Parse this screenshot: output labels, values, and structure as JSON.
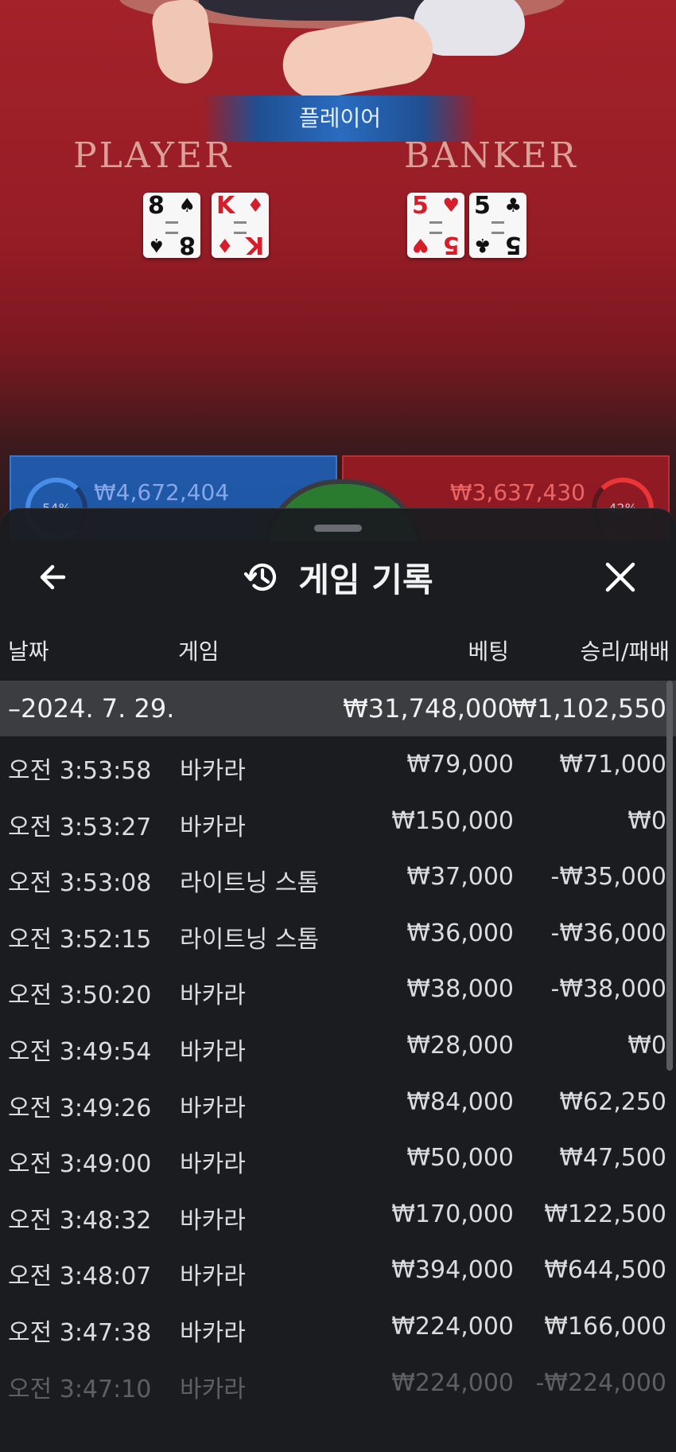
{
  "table": {
    "winner_banner": "플레이어",
    "player_title": "PLAYER",
    "banker_title": "BANKER",
    "player_cards": [
      {
        "rank": "8",
        "suit": "♠",
        "color": "#111111"
      },
      {
        "rank": "K",
        "suit": "♦",
        "color": "#d61e2b"
      }
    ],
    "banker_cards": [
      {
        "rank": "5",
        "suit": "♥",
        "color": "#d61e2b"
      },
      {
        "rank": "5",
        "suit": "♣",
        "color": "#111111"
      }
    ],
    "player_percent": "54%",
    "player_amount": "₩4,672,404",
    "banker_amount": "₩3,637,430",
    "banker_percent": "42%"
  },
  "sheet": {
    "title": "게임 기록",
    "back_icon": "arrow-left-icon",
    "history_icon": "history-icon",
    "close_icon": "close-icon",
    "columns": {
      "date": "날짜",
      "game": "게임",
      "bet": "베팅",
      "win_loss": "승리/패배"
    },
    "date_group": {
      "date": "–2024. 7. 29.",
      "total_bet": "₩31,748,000",
      "total_win": "₩1,102,550"
    },
    "rows": [
      {
        "time": "오전 3:53:58",
        "game": "바카라",
        "bet": "₩79,000",
        "result": "₩71,000"
      },
      {
        "time": "오전 3:53:27",
        "game": "바카라",
        "bet": "₩150,000",
        "result": "₩0"
      },
      {
        "time": "오전 3:53:08",
        "game": "라이트닝 스톰",
        "bet": "₩37,000",
        "result": "-₩35,000"
      },
      {
        "time": "오전 3:52:15",
        "game": "라이트닝 스톰",
        "bet": "₩36,000",
        "result": "-₩36,000"
      },
      {
        "time": "오전 3:50:20",
        "game": "바카라",
        "bet": "₩38,000",
        "result": "-₩38,000"
      },
      {
        "time": "오전 3:49:54",
        "game": "바카라",
        "bet": "₩28,000",
        "result": "₩0"
      },
      {
        "time": "오전 3:49:26",
        "game": "바카라",
        "bet": "₩84,000",
        "result": "₩62,250"
      },
      {
        "time": "오전 3:49:00",
        "game": "바카라",
        "bet": "₩50,000",
        "result": "₩47,500"
      },
      {
        "time": "오전 3:48:32",
        "game": "바카라",
        "bet": "₩170,000",
        "result": "₩122,500"
      },
      {
        "time": "오전 3:48:07",
        "game": "바카라",
        "bet": "₩394,000",
        "result": "₩644,500"
      },
      {
        "time": "오전 3:47:38",
        "game": "바카라",
        "bet": "₩224,000",
        "result": "₩166,000"
      },
      {
        "time": "오전 3:47:10",
        "game": "바카라",
        "bet": "₩224,000",
        "result": "-₩224,000"
      }
    ]
  }
}
